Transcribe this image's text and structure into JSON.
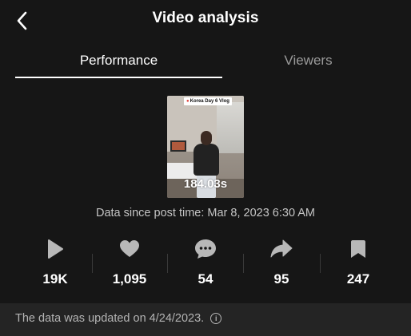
{
  "header": {
    "title": "Video analysis",
    "back_icon": "chevron-left-icon"
  },
  "tabs": [
    {
      "label": "Performance",
      "active": true
    },
    {
      "label": "Viewers",
      "active": false
    }
  ],
  "video": {
    "caption": "Korea Day 6 Vlog",
    "caption_icon": "location-pin-icon",
    "duration": "184.03s"
  },
  "data_since": "Data since post time: Mar 8, 2023 6:30 AM",
  "stats": [
    {
      "icon": "play-icon",
      "value": "19K"
    },
    {
      "icon": "heart-icon",
      "value": "1,095"
    },
    {
      "icon": "comment-icon",
      "value": "54"
    },
    {
      "icon": "share-icon",
      "value": "95"
    },
    {
      "icon": "bookmark-icon",
      "value": "247"
    }
  ],
  "footer": {
    "text": "The data was updated on 4/24/2023.",
    "info_icon": "i"
  },
  "colors": {
    "background": "#161616",
    "footer_background": "#242424",
    "active_tab": "#ffffff",
    "inactive_tab": "#9a9a9a",
    "stat_icon": "#b8b8b8"
  }
}
